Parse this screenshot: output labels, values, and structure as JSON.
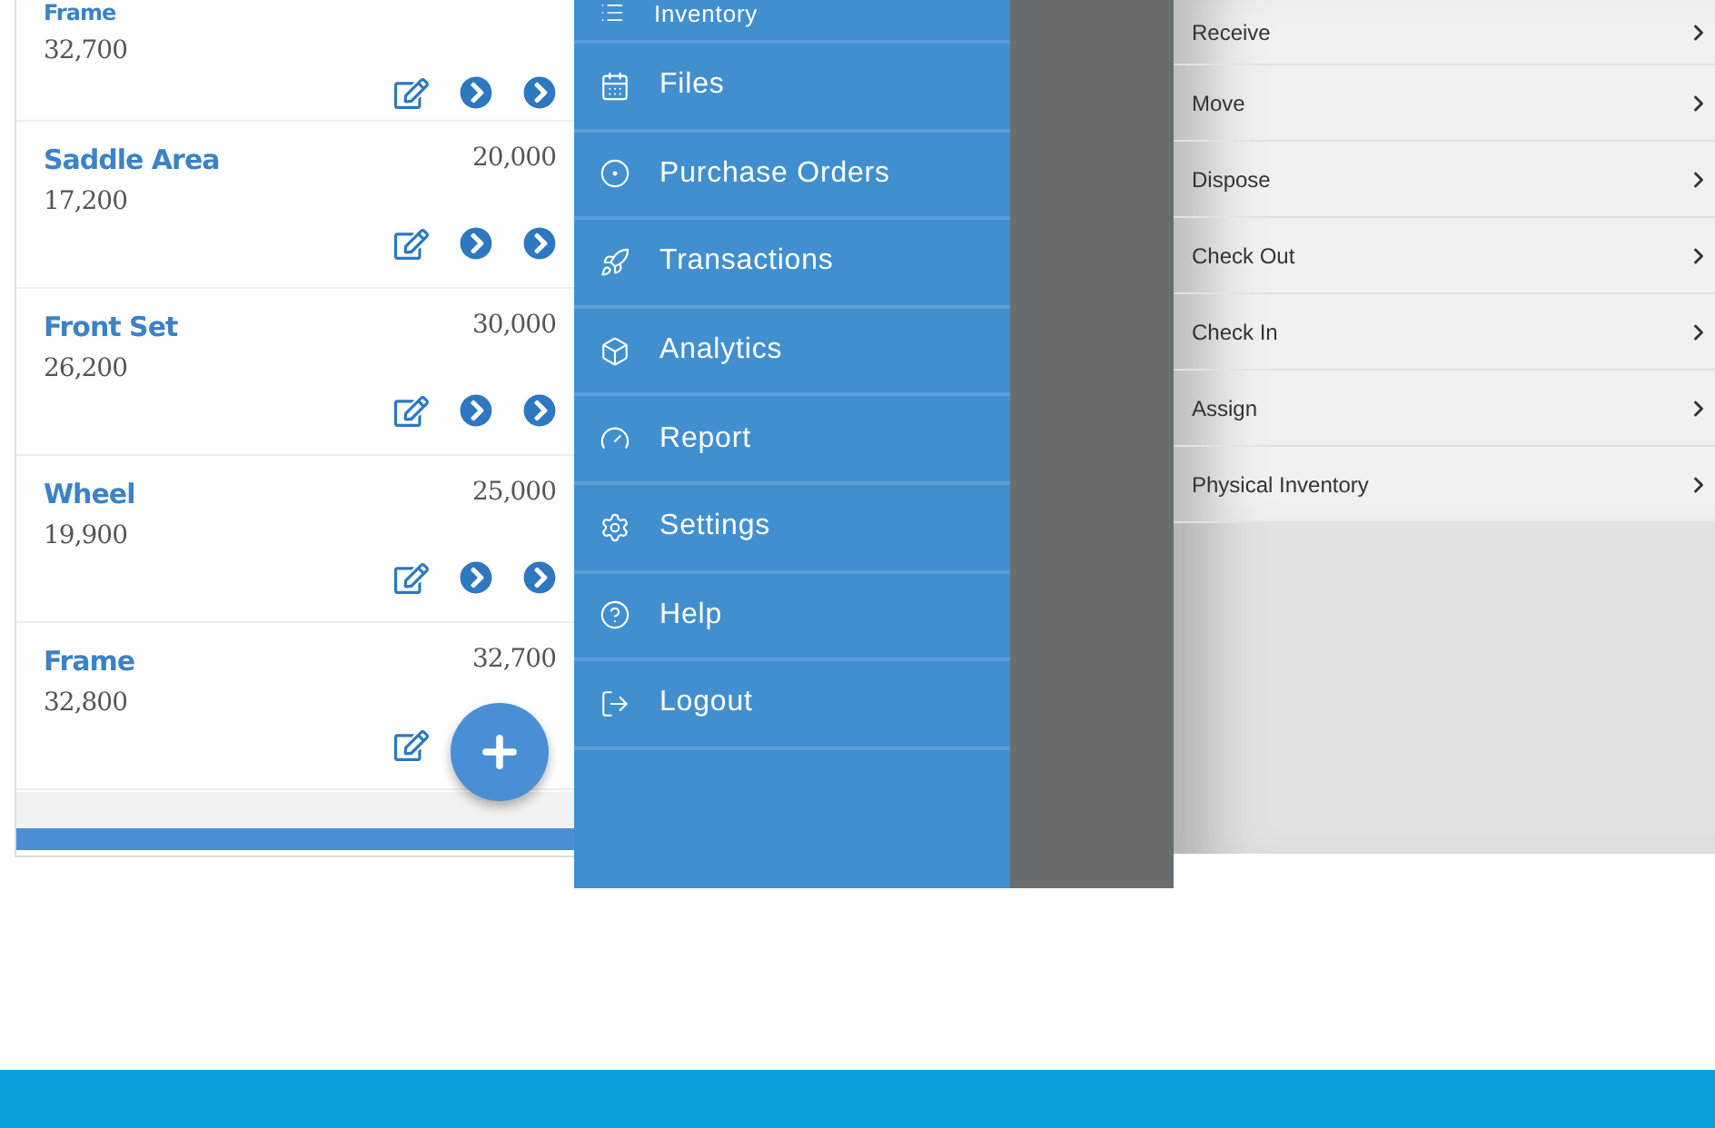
{
  "inventory_list": {
    "rows": [
      {
        "name": "Frame",
        "quantity": "32,700"
      },
      {
        "name": "Saddle Area",
        "target": "20,000",
        "quantity": "17,200"
      },
      {
        "name": "Front Set",
        "target": "30,000",
        "quantity": "26,200"
      },
      {
        "name": "Wheel",
        "target": "25,000",
        "quantity": "19,900"
      },
      {
        "name": "Frame",
        "target": "32,700",
        "quantity": "32,800"
      }
    ]
  },
  "side_menu": {
    "items": [
      {
        "label": "Inventory"
      },
      {
        "label": "Files"
      },
      {
        "label": "Purchase Orders"
      },
      {
        "label": "Transactions"
      },
      {
        "label": "Analytics"
      },
      {
        "label": "Report"
      },
      {
        "label": "Settings"
      },
      {
        "label": "Help"
      },
      {
        "label": "Logout"
      }
    ]
  },
  "transactions_menu": {
    "items": [
      {
        "label": "Receive"
      },
      {
        "label": "Move"
      },
      {
        "label": "Dispose"
      },
      {
        "label": "Check Out"
      },
      {
        "label": "Check In"
      },
      {
        "label": "Assign"
      },
      {
        "label": "Physical Inventory"
      }
    ]
  }
}
